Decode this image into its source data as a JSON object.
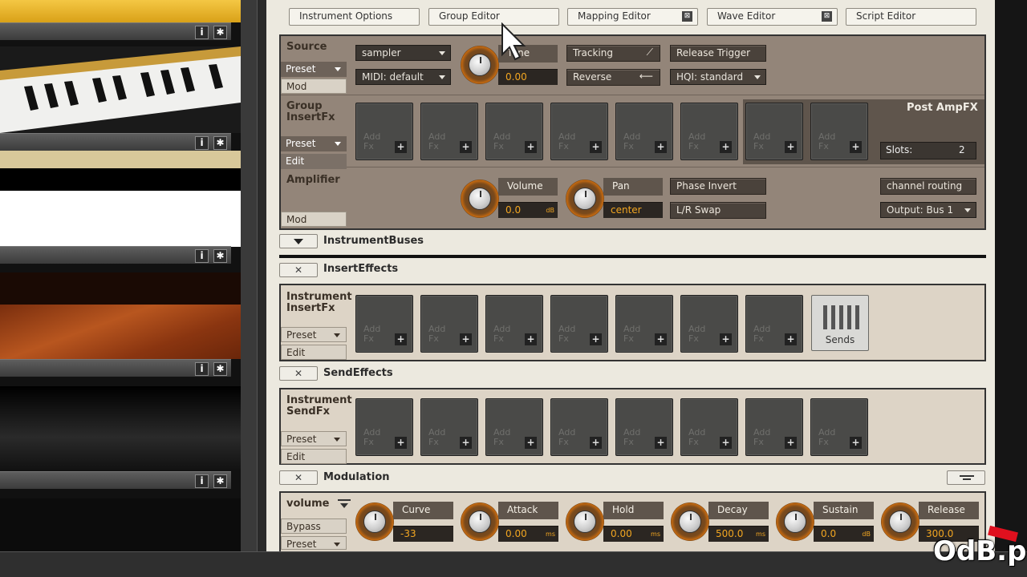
{
  "tabs": [
    {
      "label": "Instrument Options"
    },
    {
      "label": "Group Editor"
    },
    {
      "label": "Mapping Editor"
    },
    {
      "label": "Wave Editor"
    },
    {
      "label": "Script Editor"
    }
  ],
  "source": {
    "label": "Source",
    "preset": "Preset",
    "mod": "Mod",
    "mode": "sampler",
    "midi": "MIDI: default",
    "tune_label": "Tune",
    "tune_value": "0.00",
    "tracking": "Tracking",
    "reverse": "Reverse",
    "release_trigger": "Release Trigger",
    "hqi": "HQI: standard"
  },
  "group_insert": {
    "label_line1": "Group",
    "label_line2": "InsertFx",
    "preset": "Preset",
    "edit": "Edit",
    "slot_text_1": "Add",
    "slot_text_2": "Fx",
    "post_amp": "Post AmpFX",
    "slots_label": "Slots:",
    "slots_value": "2"
  },
  "amplifier": {
    "label": "Amplifier",
    "mod": "Mod",
    "volume_label": "Volume",
    "volume_value": "0.0",
    "volume_unit": "dB",
    "pan_label": "Pan",
    "pan_value": "center",
    "phase_invert": "Phase Invert",
    "lr_swap": "L/R Swap",
    "channel_routing": "channel routing",
    "output": "Output: Bus 1"
  },
  "sections": {
    "instrument_buses": "InstrumentBuses",
    "insert_effects": "InsertEffects",
    "send_effects": "SendEffects",
    "modulation": "Modulation"
  },
  "instrument_insert": {
    "label_line1": "Instrument",
    "label_line2": "InsertFx",
    "preset": "Preset",
    "edit": "Edit",
    "sends": "Sends"
  },
  "instrument_send": {
    "label_line1": "Instrument",
    "label_line2": "SendFx",
    "preset": "Preset",
    "edit": "Edit"
  },
  "modulation": {
    "target": "volume",
    "bypass": "Bypass",
    "preset": "Preset",
    "curve_label": "Curve",
    "curve_value": "-33",
    "attack_label": "Attack",
    "attack_value": "0.00",
    "attack_unit": "ms",
    "hold_label": "Hold",
    "hold_value": "0.00",
    "hold_unit": "ms",
    "decay_label": "Decay",
    "decay_value": "500.0",
    "decay_unit": "ms",
    "sustain_label": "Sustain",
    "sustain_value": "0.0",
    "sustain_unit": "dB",
    "release_label": "Release",
    "release_value": "300.0"
  },
  "library_buttons": {
    "info": "i",
    "gear": "✱"
  },
  "watermark": "OdB.pl",
  "colors": {
    "accent": "#f2a621",
    "panel": "#938579",
    "knob_ring": "#c66a10"
  }
}
